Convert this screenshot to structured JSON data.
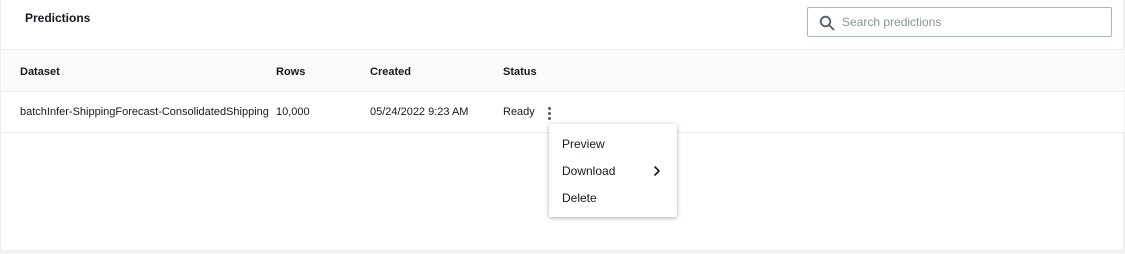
{
  "panel": {
    "title": "Predictions"
  },
  "search": {
    "placeholder": "Search predictions",
    "icon": "search-icon"
  },
  "table": {
    "columns": [
      "Dataset",
      "Rows",
      "Created",
      "Status"
    ],
    "rows": [
      {
        "dataset": "batchInfer-ShippingForecast-ConsolidatedShipping",
        "rows": "10,000",
        "created": "05/24/2022 9:23 AM",
        "status": "Ready"
      }
    ]
  },
  "actions_menu": {
    "trigger_icon": "more-vertical-icon",
    "items": [
      {
        "label": "Preview"
      },
      {
        "label": "Download",
        "icon": "chevron-right-icon"
      },
      {
        "label": "Delete"
      }
    ]
  },
  "colors": {
    "page_bg": "#f2f3f3",
    "header_bg": "#fafafa",
    "border": "#eaeded",
    "text": "#16191f",
    "placeholder": "#879596"
  }
}
